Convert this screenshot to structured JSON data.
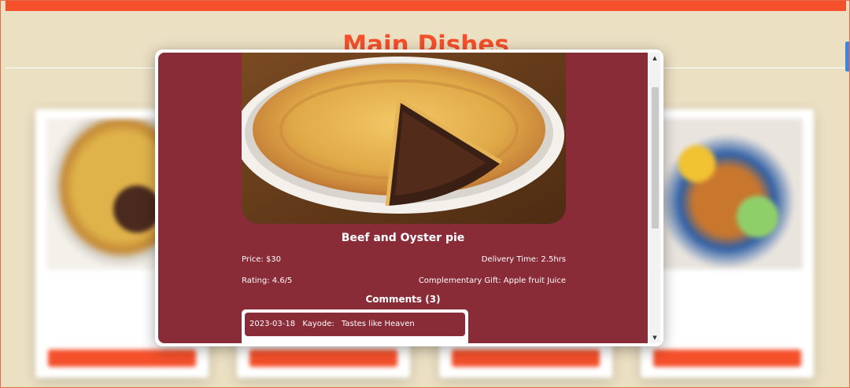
{
  "page": {
    "section_title": "Main Dishes"
  },
  "cards": [
    {
      "image": "beef-and-oyster-pie",
      "button_label": ""
    },
    {
      "image": "dish",
      "button_label": ""
    },
    {
      "image": "dish",
      "button_label": ""
    },
    {
      "image": "salad",
      "button_label": ""
    }
  ],
  "modal": {
    "dish_name": "Beef and Oyster pie",
    "price_label": "Price: $30",
    "delivery_label": "Delivery Time: 2.5hrs",
    "rating_label": "Rating: 4.6/5",
    "gift_label": "Complementary Gift: Apple fruit Juice",
    "comments_title": "Comments (3)",
    "comments": [
      {
        "date": "2023-03-18",
        "author": "Kayode:",
        "text": "Tastes like Heaven"
      }
    ]
  },
  "icons": {
    "scroll_up": "triangle-up-icon",
    "scroll_down": "triangle-down-icon"
  },
  "colors": {
    "accent": "#f4502b",
    "modal_bg": "#8a2b38",
    "page_bg": "#ece0c3"
  }
}
